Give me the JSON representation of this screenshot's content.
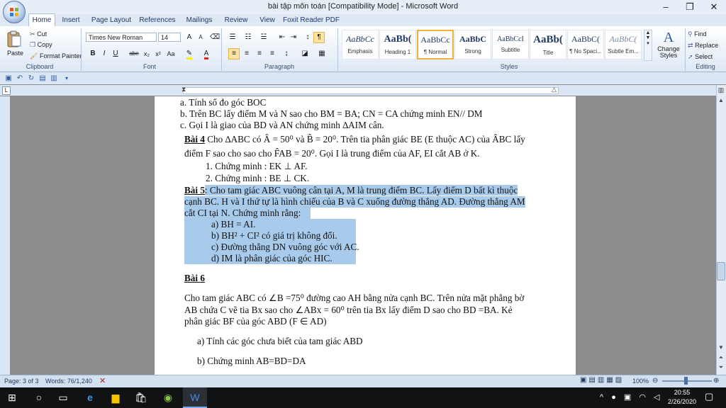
{
  "window": {
    "title": "bài tập môn toán [Compatibility Mode] - Microsoft Word",
    "min": "–",
    "restore": "❐",
    "close": "✕"
  },
  "tabs": [
    "Home",
    "Insert",
    "Page Layout",
    "References",
    "Mailings",
    "Review",
    "View",
    "Foxit Reader PDF"
  ],
  "clipboard": {
    "paste": "Paste",
    "cut": "Cut",
    "copy": "Copy",
    "format_painter": "Format Painter",
    "label": "Clipboard"
  },
  "font": {
    "name": "Times New Roman",
    "size": "14",
    "label": "Font",
    "buttons": [
      "B",
      "I",
      "U",
      "abe",
      "x₂",
      "x²",
      "Aa"
    ]
  },
  "paragraph": {
    "label": "Paragraph"
  },
  "styles": {
    "label": "Styles",
    "items": [
      {
        "sample": "AaBbCc",
        "name": "Emphasis"
      },
      {
        "sample": "AaBb(",
        "name": "Heading 1"
      },
      {
        "sample": "AaBbCc",
        "name": "¶ Normal"
      },
      {
        "sample": "AaBbC",
        "name": "Strong"
      },
      {
        "sample": "AaBbCcI",
        "name": "Subtitle"
      },
      {
        "sample": "AaBb(",
        "name": "Title"
      },
      {
        "sample": "AaBbC(",
        "name": "¶ No Spaci..."
      },
      {
        "sample": "AaBbC(",
        "name": "Subtle Em..."
      }
    ],
    "change_styles": "Change Styles"
  },
  "editing": {
    "label": "Editing",
    "find": "Find",
    "replace": "Replace",
    "select": "Select"
  },
  "doc": {
    "l1": "a.  Tính số đo góc BOC",
    "l2": "b.  Trên BC lấy điểm M và N sao cho BM = BA; CN = CA chứng minh EN// DM",
    "l3": "c.  Gọi I là giao của BD và AN chứng minh ∆AIM cân.",
    "b4_title": "Bài 4",
    "b4_text": " Cho ∆ABC có Â = 50⁰  và B̂ = 20⁰. Trên tia phân giác BE (E thuộc AC) của ÂBC lấy",
    "b4_text2": "điểm F sao cho sao cho F̂AB = 20⁰. Gọi I là trung điểm của AF, EI cắt AB ở K.",
    "b4_1": "1.  Chứng minh : EK ⊥ AF.",
    "b4_2": "2.  Chứng minh : BE ⊥ CK.",
    "b5_title": "Bài 5",
    "b5_text": ": Cho tam giác ABC vuông cân tại A, M là trung điểm BC. Lấy điểm D bất kì thuộc",
    "b5_text2": "cạnh BC. H và I thứ tự là hình chiếu của B và C xuống đường thẳng  AD. Đường thẳng AM",
    "b5_text3": "cắt CI tại N. Chứng minh rằng:",
    "b5_a": "a) BH = AI.",
    "b5_b": "b) BH² + CI² có giá trị không đổi.",
    "b5_c": "c) Đường thẳng DN vuông góc với AC.",
    "b5_d": "d) IM là phân giác của góc HIC.",
    "b6_title": "Bài 6",
    "b6_text": "Cho tam giác ABC có  ∠B =75⁰ đường cao  AH  bằng nửa cạnh BC. Trên nửa mặt phẳng bờ",
    "b6_text2": "AB chứa C vẽ tia Bx sao cho  ∠ABx = 60⁰  trên tia Bx lấy điểm D sao cho BD =BA. Kẻ",
    "b6_text3": "phân giác BF của góc ABD (F ∈ AD)",
    "b6_a": "a)  Tính các góc chưa biết  của tam giác ABD",
    "b6_b": "b)  Chứng minh AB=BD=DA"
  },
  "status": {
    "page": "Page: 3 of 3",
    "words": "Words: 76/1,240",
    "zoom": "100%"
  },
  "taskbar": {
    "time": "20:55",
    "date": "2/26/2020"
  }
}
